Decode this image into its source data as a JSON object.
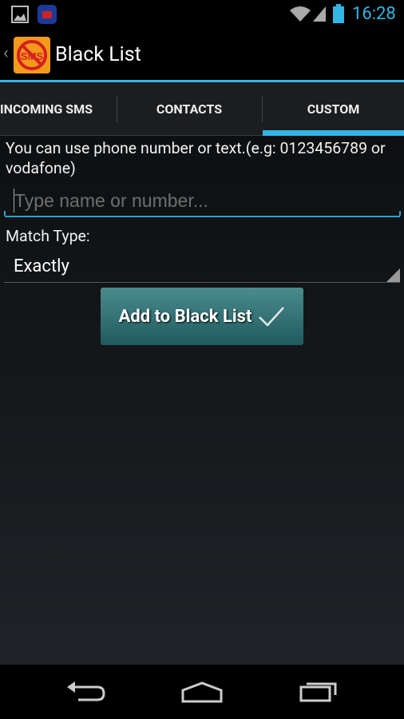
{
  "status_bar": {
    "time": "16:28",
    "icons": [
      "picture-icon",
      "app-notification-icon",
      "wifi-icon",
      "signal-icon",
      "battery-icon"
    ]
  },
  "action_bar": {
    "title": "Black List",
    "logo_text": "SMS"
  },
  "tabs": [
    {
      "label": "INCOMING SMS"
    },
    {
      "label": "CONTACTS"
    },
    {
      "label": "CUSTOM",
      "selected": true
    }
  ],
  "form": {
    "hint": "You can use phone number or text.(e.g: 0123456789 or vodafone)",
    "input_placeholder": "Type name or number...",
    "input_value": "",
    "match_label": "Match Type:",
    "match_value": "Exactly",
    "add_button": "Add to Black List"
  },
  "colors": {
    "accent": "#33b5e5",
    "button": "#2e6e70"
  }
}
